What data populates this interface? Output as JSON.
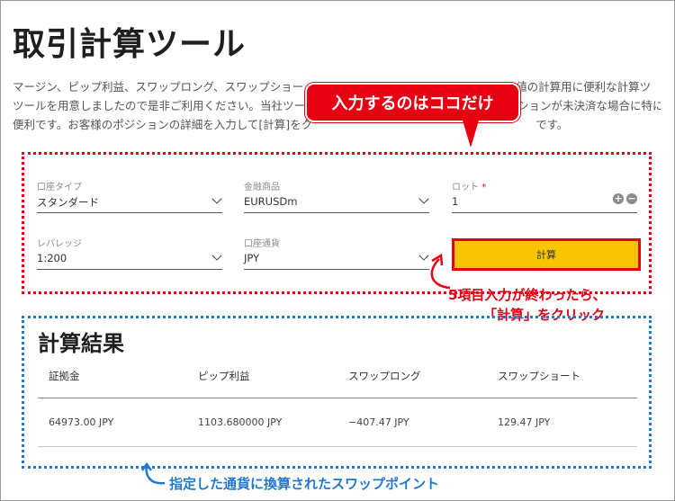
{
  "page": {
    "title": "取引計算ツール",
    "intro_lines": [
      "マージン、ピップ利益、スワップロング、スワップショー",
      "ツールを用意しましたので是非ご利用ください。当社ツー",
      "便利です。お客様のポジションの詳細を入力して[計算]をク"
    ],
    "intro_tail": [
      "値の計算用に便利な計算ツ",
      "ションが未決済な場合に特に",
      "です。"
    ]
  },
  "callout": {
    "text": "入力するのはココだけ",
    "color": "#e60012"
  },
  "form": {
    "account_type": {
      "label": "口座タイプ",
      "value": "スタンダード"
    },
    "instrument": {
      "label": "金融商品",
      "value": "EURUSDm"
    },
    "lot": {
      "label": "ロット",
      "required_mark": "*",
      "value": "1",
      "plus": "+",
      "minus": "−"
    },
    "leverage": {
      "label": "レバレッジ",
      "value": "1:200"
    },
    "currency": {
      "label": "口座通貨",
      "value": "JPY"
    },
    "calculate_label": "計算"
  },
  "annotations": {
    "step_note_line1": "5項目入力が終わったら、",
    "step_note_line2": "「計算」をクリック",
    "swap_note": "指定した通貨に換算されたスワップポイント",
    "red": "#e60012",
    "blue": "#1f78d1",
    "button_yellow": "#f7c600"
  },
  "results": {
    "title": "計算結果",
    "columns": [
      "証拠金",
      "ピップ利益",
      "スワップロング",
      "スワップショート"
    ],
    "values": [
      "64973.00 JPY",
      "1103.680000 JPY",
      "−407.47 JPY",
      "129.47 JPY"
    ]
  }
}
